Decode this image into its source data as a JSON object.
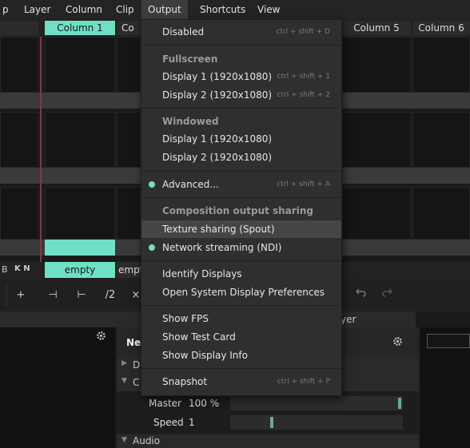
{
  "menubar": {
    "items": [
      {
        "label": "p"
      },
      {
        "label": "Layer"
      },
      {
        "label": "Column"
      },
      {
        "label": "Clip"
      },
      {
        "label": "Output"
      },
      {
        "label": "Shortcuts"
      },
      {
        "label": "View"
      }
    ]
  },
  "columns": {
    "col1": "Column 1",
    "col2_partial": "Co",
    "col5": "Column 5",
    "col6": "Column 6"
  },
  "clip_row": {
    "letter": "B",
    "nav": "K N",
    "clip1": "empty",
    "clip2_partial": "empt"
  },
  "toolbar": {
    "plus": "+",
    "tick_left": "⊣",
    "tick_right": "⊢",
    "divide": "/2",
    "close": "×"
  },
  "panel": {
    "title_partial": "Ne",
    "right_partial": "yer",
    "row_d": "D",
    "row_c": "C",
    "master_label": "Master",
    "master_value": "100 %",
    "speed_label": "Speed",
    "speed_value": "1",
    "audio_label": "Audio"
  },
  "output_menu": {
    "disabled": {
      "label": "Disabled",
      "shortcut": "ctrl + shift + D"
    },
    "fullscreen_header": "Fullscreen",
    "fs_display1": {
      "label": "Display 1 (1920x1080)",
      "shortcut": "ctrl + shift + 1"
    },
    "fs_display2": {
      "label": "Display 2 (1920x1080)",
      "shortcut": "ctrl + shift + 2"
    },
    "windowed_header": "Windowed",
    "win_display1": {
      "label": "Display 1 (1920x1080)"
    },
    "win_display2": {
      "label": "Display 2 (1920x1080)"
    },
    "advanced": {
      "label": "Advanced...",
      "shortcut": "ctrl + shift + A"
    },
    "sharing_header": "Composition output sharing",
    "spout": {
      "label": "Texture sharing (Spout)"
    },
    "ndi": {
      "label": "Network streaming (NDI)"
    },
    "identify": {
      "label": "Identify Displays"
    },
    "open_prefs": {
      "label": "Open System Display Preferences"
    },
    "show_fps": {
      "label": "Show FPS"
    },
    "show_test_card": {
      "label": "Show Test Card"
    },
    "show_display_info": {
      "label": "Show Display Info"
    },
    "snapshot": {
      "label": "Snapshot",
      "shortcut": "ctrl + shift + P"
    }
  },
  "colors": {
    "accent": "#6fe0c5",
    "menu_bg": "#2f2f2f",
    "highlight": "#454545"
  },
  "icons": {
    "gear": "gear-icon",
    "undo": "undo-icon",
    "redo": "redo-icon"
  }
}
